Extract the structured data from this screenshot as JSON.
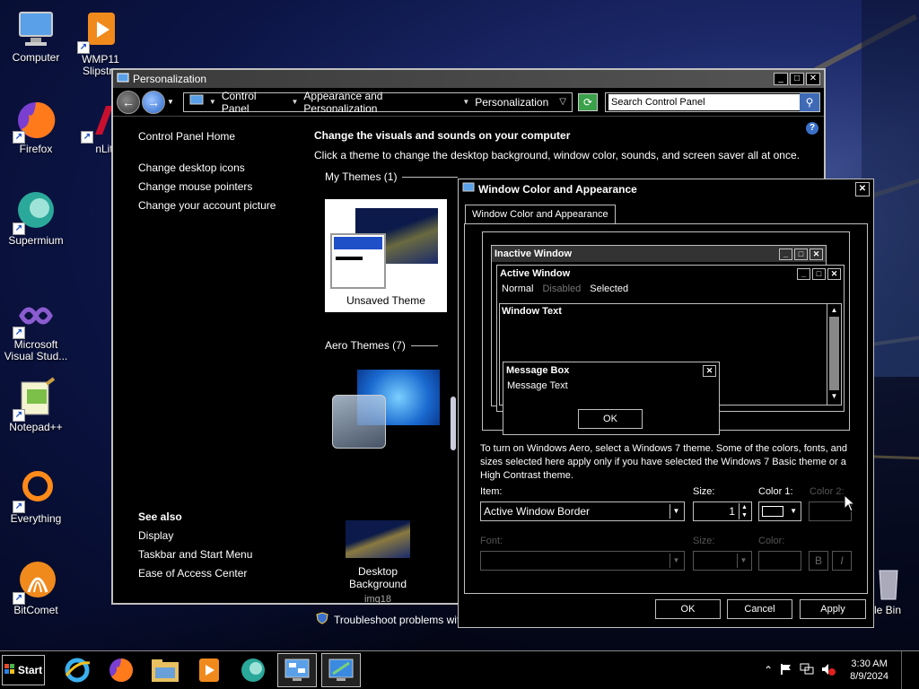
{
  "desktop": {
    "icons": [
      {
        "label": "Computer",
        "icon": "computer-icon"
      },
      {
        "label": "WMP11 Slipstre...",
        "icon": "wmp-icon"
      },
      {
        "label": "Firefox",
        "icon": "firefox-icon"
      },
      {
        "label": "nLite",
        "icon": "nlite-icon"
      },
      {
        "label": "Supermium",
        "icon": "supermium-icon"
      },
      {
        "label": "Microsoft Visual Stud...",
        "icon": "visual-studio-icon"
      },
      {
        "label": "Notepad++",
        "icon": "notepad-plus-plus-icon"
      },
      {
        "label": "Everything",
        "icon": "everything-icon"
      },
      {
        "label": "BitComet",
        "icon": "bitcomet-icon"
      },
      {
        "label": "Recycle Bin",
        "icon": "recycle-bin-icon"
      }
    ],
    "visible_labels": {
      "computer": "Computer",
      "wmp": "WMP11",
      "wmp2": "Slipstre",
      "firefox": "Firefox",
      "nlite": "nLit",
      "supermium": "Supermium",
      "vs1": "Microsoft",
      "vs2": "Visual Stud...",
      "notepad": "Notepad++",
      "everything": "Everything",
      "bitcomet": "BitComet",
      "recycle": "le Bin"
    }
  },
  "personalization": {
    "title": "Personalization",
    "breadcrumbs": [
      "Control Panel",
      "Appearance and Personalization",
      "Personalization"
    ],
    "search_placeholder": "Search Control Panel",
    "left_nav": {
      "home": "Control Panel Home",
      "links": [
        "Change desktop icons",
        "Change mouse pointers",
        "Change your account picture"
      ]
    },
    "see_also": {
      "heading": "See also",
      "links": [
        "Display",
        "Taskbar and Start Menu",
        "Ease of Access Center"
      ]
    },
    "heading": "Change the visuals and sounds on your computer",
    "description": "Click a theme to change the desktop background, window color, sounds, and screen saver all at once.",
    "my_themes": "My Themes (1)",
    "unsaved_theme": "Unsaved Theme",
    "aero_themes": "Aero Themes (7)",
    "desktop_background_label": "Desktop Background",
    "desktop_background_value": "img18",
    "troubleshoot": "Troubleshoot problems wit"
  },
  "dialog": {
    "title": "Window Color and Appearance",
    "tab": "Window Color and Appearance",
    "preview": {
      "inactive_window": "Inactive Window",
      "active_window": "Active Window",
      "menu_normal": "Normal",
      "menu_disabled": "Disabled",
      "menu_selected": "Selected",
      "window_text": "Window Text",
      "message_box": "Message Box",
      "message_text": "Message Text",
      "ok": "OK"
    },
    "info": "To turn on Windows Aero, select a Windows 7 theme.  Some of the colors, fonts, and sizes selected here apply only if you have selected the Windows 7 Basic theme or a High Contrast theme.",
    "item_label": "Item:",
    "item_value": "Active Window Border",
    "size_label": "Size:",
    "size_value": "1",
    "color1_label": "Color 1:",
    "color2_label": "Color 2:",
    "font_label": "Font:",
    "font_size_label": "Size:",
    "font_color_label": "Color:",
    "bold_label": "B",
    "italic_label": "I",
    "ok": "OK",
    "cancel": "Cancel",
    "apply": "Apply"
  },
  "taskbar": {
    "start": "Start",
    "apps": [
      "internet-explorer-icon",
      "firefox-icon",
      "file-explorer-icon",
      "media-player-icon",
      "supermium-icon",
      "control-panel-icon",
      "personalization-icon"
    ],
    "time": "3:30 AM",
    "date": "8/9/2024"
  }
}
